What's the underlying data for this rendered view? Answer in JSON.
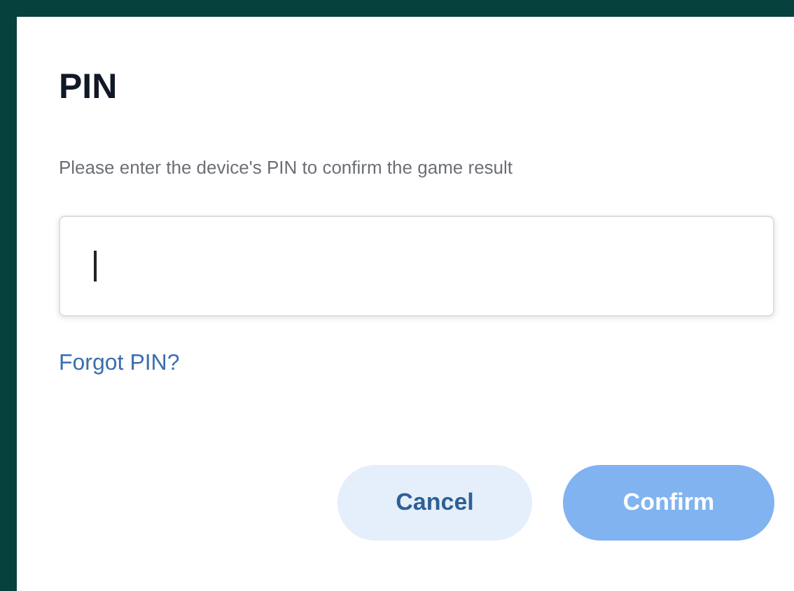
{
  "dialog": {
    "title": "PIN",
    "description": "Please enter the device's PIN to confirm the game result",
    "pin_field": {
      "focused": true
    },
    "forgot_link": "Forgot PIN?",
    "buttons": [
      {
        "label": "Cancel",
        "kind": "secondary",
        "disabled": false
      },
      {
        "label": "Confirm",
        "kind": "primary",
        "disabled": true
      }
    ]
  }
}
